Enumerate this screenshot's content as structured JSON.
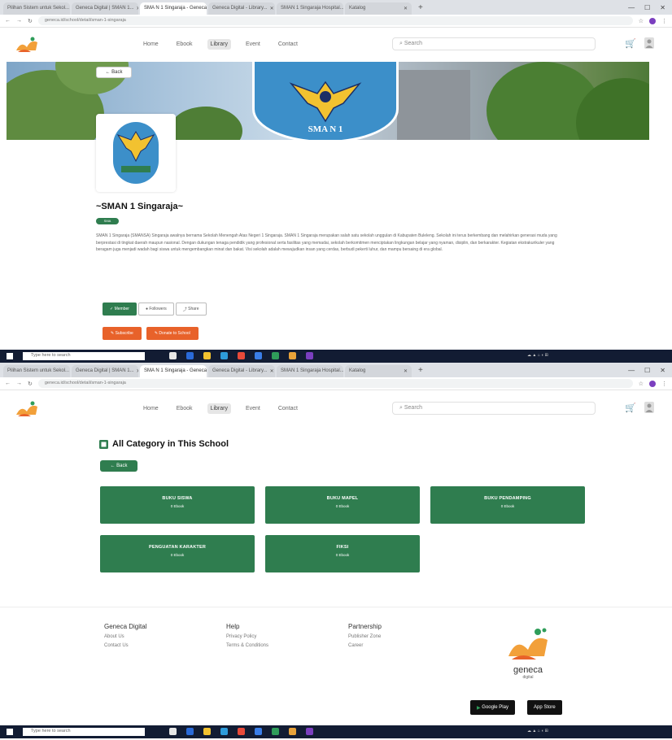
{
  "browser": {
    "tabs": [
      {
        "label": "Pilihan Sistem untuk Sekol..."
      },
      {
        "label": "Geneca Digital | SMAN 1..."
      },
      {
        "label": "SMA N 1 Singaraja - Geneca..."
      },
      {
        "label": "Geneca Digital - Library..."
      },
      {
        "label": "SMAN 1 Singaraja Hospital..."
      },
      {
        "label": "Katalog"
      }
    ],
    "active_tab": 2,
    "url": "geneca.id/school/detail/sman-1-singaraja"
  },
  "site": {
    "nav": [
      "Home",
      "Ebook",
      "Library",
      "Event",
      "Contact"
    ],
    "active_nav": 2,
    "search_placeholder": "Search"
  },
  "school": {
    "back_label": "← Back",
    "banner_text": "SMA N 1",
    "name": "~SMAN 1 Singaraja~",
    "badge": "SMA",
    "description": "SMAN 1 Singaraja (SMANSA) Singaraja awalnya bernama Sekolah Menengah Atas Negeri 1 Singaraja. SMAN 1 Singaraja merupakan salah satu sekolah unggulan di Kabupaten Buleleng. Sekolah ini terus berkembang dan melahirkan generasi muda yang berprestasi di tingkat daerah maupun nasional. Dengan dukungan tenaga pendidik yang profesional serta fasilitas yang memadai, sekolah berkomitmen menciptakan lingkungan belajar yang nyaman, disiplin, dan berkarakter. Kegiatan ekstrakurikuler yang beragam juga menjadi wadah bagi siswa untuk mengembangkan minat dan bakat. Visi sekolah adalah mewujudkan insan yang cerdas, berbudi pekerti luhur, dan mampu bersaing di era global.",
    "actions": [
      "Member",
      "Followers",
      "Share"
    ],
    "orange_buttons": [
      "Subscribe",
      "Donate to School"
    ]
  },
  "categories": {
    "title": "All Category in This School",
    "back_label": "← Back",
    "items": [
      {
        "name": "BUKU SISWA",
        "count": "0 Ebook"
      },
      {
        "name": "BUKU MAPEL",
        "count": "0 Ebook"
      },
      {
        "name": "BUKU PENDAMPING",
        "count": "0 Ebook"
      },
      {
        "name": "PENGUATAN KARAKTER",
        "count": "0 Ebook"
      },
      {
        "name": "FIKSI",
        "count": "0 Ebook"
      }
    ]
  },
  "footer": {
    "col1": {
      "title": "Geneca Digital",
      "links": [
        "About Us",
        "Contact Us"
      ]
    },
    "col2": {
      "title": "Help",
      "links": [
        "Privacy Policy",
        "Terms & Conditions"
      ]
    },
    "col3": {
      "title": "Partnership",
      "links": [
        "Publisher Zone",
        "Career"
      ]
    },
    "brand": "geneca",
    "brand_sub": "digital",
    "google_play": "Google Play",
    "app_store": "App Store"
  },
  "taskbar": {
    "search_placeholder": "Type here to search",
    "search_placeholder2": "Type here to search"
  },
  "colors": {
    "green": "#2f7d4f",
    "orange": "#e8622a",
    "navy": "#121c33"
  }
}
